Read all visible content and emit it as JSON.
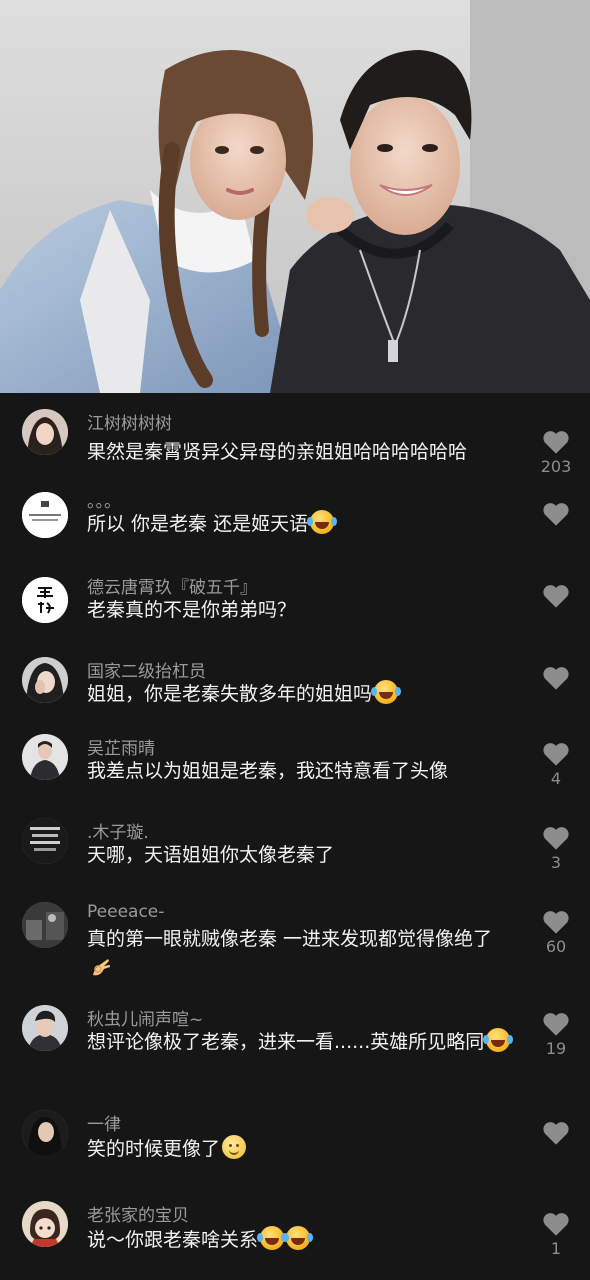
{
  "photo": {
    "alt": ""
  },
  "comments": [
    {
      "user": "江树树树树",
      "text": "果然是秦霄贤异父异母的亲姐姐哈哈哈哈哈哈",
      "emoji": [],
      "likes": "203",
      "avatar": "girl-dark-hair"
    },
    {
      "user": "。。。",
      "text": "所以 你是老秦 还是姬天语",
      "emoji": [
        "laugh"
      ],
      "likes": "",
      "avatar": "white-text-card"
    },
    {
      "user": "德云唐霄玖『破五千』",
      "text": "老秦真的不是你弟弟吗？",
      "emoji": [],
      "likes": "",
      "avatar": "calligraphy-white"
    },
    {
      "user": "国家二级抬杠员",
      "text": "姐姐，你是老秦失散多年的姐姐吗",
      "emoji": [
        "laugh"
      ],
      "likes": "",
      "avatar": "girl-hand-face"
    },
    {
      "user": "吴芷雨晴",
      "text": "我差点以为姐姐是老秦，我还特意看了头像",
      "emoji": [],
      "likes": "4",
      "avatar": "person-suit"
    },
    {
      "user": ".木子璇.",
      "text": "天哪，天语姐姐你太像老秦了",
      "emoji": [],
      "likes": "3",
      "avatar": "dark-text-card"
    },
    {
      "user": "Peeeace-",
      "text": "真的第一眼就贼像老秦 一进来发现都觉得像绝了",
      "emoji": [
        "ok"
      ],
      "likes": "60",
      "avatar": "dark-scene"
    },
    {
      "user": "秋虫儿闹声喧~",
      "text": "想评论像极了老秦，进来一看......英雄所见略同",
      "emoji": [
        "laugh"
      ],
      "likes": "19",
      "avatar": "boy-portrait"
    },
    {
      "user": "一律",
      "text": "笑的时候更像了",
      "emoji": [
        "smile"
      ],
      "likes": "",
      "avatar": "girl-long-hair"
    },
    {
      "user": "老张家的宝贝",
      "text": "说～你跟老秦啥关系",
      "emoji": [
        "laugh",
        "laugh"
      ],
      "likes": "1",
      "avatar": "cartoon-girl"
    }
  ],
  "colors": {
    "background": "#161616",
    "username": "#9a9a9a",
    "text": "#f1f1f1",
    "like_icon": "#8d8d8d"
  },
  "icons": {
    "like": "heart-icon"
  }
}
